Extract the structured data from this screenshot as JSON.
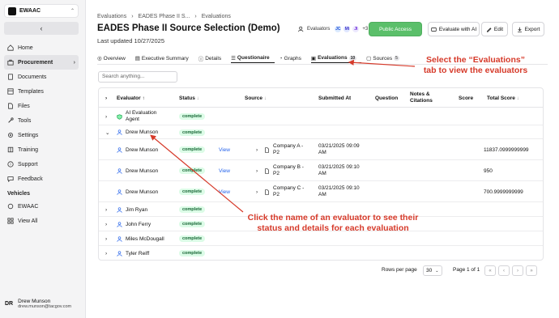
{
  "workspace": {
    "name": "EWAAC"
  },
  "sidebar": {
    "items": [
      {
        "label": "Home"
      },
      {
        "label": "Procurement"
      },
      {
        "label": "Documents"
      },
      {
        "label": "Templates"
      },
      {
        "label": "Files"
      },
      {
        "label": "Tools"
      },
      {
        "label": "Settings"
      },
      {
        "label": "Training"
      },
      {
        "label": "Support"
      },
      {
        "label": "Feedback"
      }
    ],
    "section_label": "Vehicles",
    "vehicle_items": [
      {
        "label": "EWAAC"
      },
      {
        "label": "View All"
      }
    ],
    "user": {
      "initials": "DR",
      "name": "Drew Munson",
      "email": "drew.munson@tacgov.com"
    }
  },
  "breadcrumb": [
    "Evaluations",
    "EADES Phase II S...",
    "Evaluations"
  ],
  "page": {
    "title": "EADES Phase II Source Selection (Demo)",
    "updated": "Last updated 10/27/2025"
  },
  "evaluators": {
    "label": "Evaluators",
    "avatars": [
      "JC",
      "MI",
      "JI"
    ],
    "more": "+3"
  },
  "buttons": {
    "public": "Public Access",
    "evaluate": "Evaluate with AI",
    "edit": "Edit",
    "export": "Export"
  },
  "tabs": [
    {
      "label": "Overview"
    },
    {
      "label": "Executive Summary"
    },
    {
      "label": "Details"
    },
    {
      "label": "Questionaire"
    },
    {
      "label": "Graphs"
    },
    {
      "label": "Evaluations",
      "count": "10"
    },
    {
      "label": "Sources",
      "count": "5"
    }
  ],
  "search": {
    "placeholder": "Search anything..."
  },
  "table": {
    "headers": [
      "Evaluator",
      "Status",
      "Source",
      "Submitted At",
      "Question",
      "Notes & Citations",
      "Score",
      "Total Score"
    ],
    "rows": [
      {
        "name": "AI Evaluation Agent",
        "status": "complete"
      },
      {
        "name": "Drew Munson",
        "status": "complete"
      },
      {
        "name": "Drew Munson",
        "status": "complete",
        "action": "View",
        "source": "Company A - P2",
        "submitted": "03/21/2025 09:09 AM",
        "total": "11837.0999999999"
      },
      {
        "name": "Drew Munson",
        "status": "complete",
        "action": "View",
        "source": "Company B - P2",
        "submitted": "03/21/2025 09:10 AM",
        "total": "950"
      },
      {
        "name": "Drew Munson",
        "status": "complete",
        "action": "View",
        "source": "Company C - P2",
        "submitted": "03/21/2025 09:10 AM",
        "total": "700.9999999999"
      },
      {
        "name": "Jim Ryan",
        "status": "complete"
      },
      {
        "name": "John Ferry",
        "status": "complete"
      },
      {
        "name": "Miles McDougall",
        "status": "complete"
      },
      {
        "name": "Tyler Reiff",
        "status": "complete"
      }
    ]
  },
  "pagination": {
    "rows_label": "Rows per page",
    "rows_value": "30",
    "page_label": "Page 1 of 1"
  },
  "annotations": {
    "tab_hint_line1": "Select the “Evaluations”",
    "tab_hint_line2": "tab to view the evaluators",
    "name_hint_line1": "Click the name of an evaluator to see their",
    "name_hint_line2": "status and details for each evaluation",
    "color": "#d63a2a"
  }
}
